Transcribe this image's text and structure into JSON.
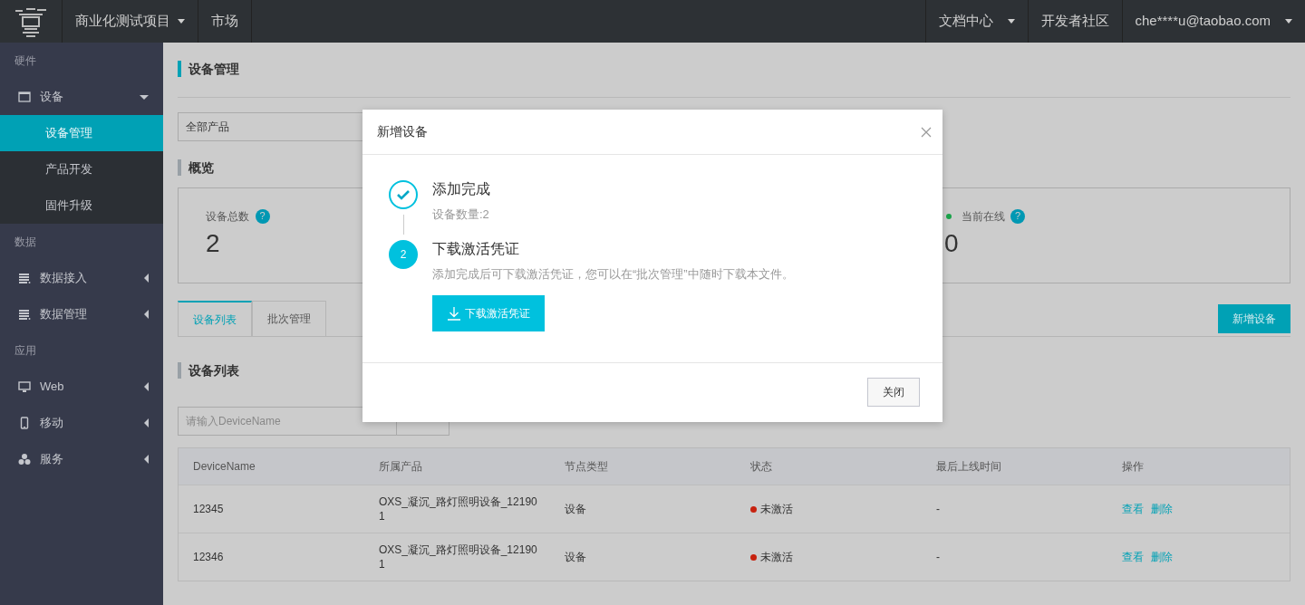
{
  "navbar": {
    "left_menus": [
      {
        "label": "商业化测试项目",
        "dropdown": true
      },
      {
        "label": "市场",
        "dropdown": false
      }
    ],
    "right_menus": [
      {
        "label": "文档中心",
        "dropdown": true
      },
      {
        "label": "开发者社区",
        "dropdown": false
      },
      {
        "label": "che****u@taobao.com",
        "dropdown": true
      }
    ]
  },
  "sidebar": {
    "sections": [
      {
        "heading": "硬件",
        "items": [
          {
            "label": "设备",
            "kind": "window",
            "expanded": true,
            "children": [
              {
                "label": "设备管理",
                "selected": true
              },
              {
                "label": "产品开发",
                "selected": false
              },
              {
                "label": "固件升级",
                "selected": false
              }
            ]
          }
        ]
      },
      {
        "heading": "数据",
        "items": [
          {
            "label": "数据接入",
            "kind": "list",
            "expanded": false
          },
          {
            "label": "数据管理",
            "kind": "list",
            "expanded": false
          }
        ]
      },
      {
        "heading": "应用",
        "items": [
          {
            "label": "Web",
            "kind": "monitor",
            "expanded": false
          },
          {
            "label": "移动",
            "kind": "phone",
            "expanded": false
          },
          {
            "label": "服务",
            "kind": "cluster",
            "expanded": false
          }
        ]
      }
    ]
  },
  "page_title": "设备管理",
  "product_select": {
    "value": "全部产品"
  },
  "overview": {
    "title": "概览",
    "stats": [
      {
        "label": "设备总数",
        "value": "2",
        "help": "?"
      },
      {
        "label": "当前在线",
        "value": "0",
        "help": "?",
        "color": "#1aa34a"
      }
    ]
  },
  "tabs": [
    {
      "label": "设备列表",
      "selected": true
    },
    {
      "label": "批次管理",
      "selected": false
    }
  ],
  "add_button": "新增设备",
  "list_title": "设备列表",
  "search": {
    "placeholder": "请输入DeviceName"
  },
  "table": {
    "columns": [
      "DeviceName",
      "所属产品",
      "节点类型",
      "状态",
      "最后上线时间",
      "操作"
    ],
    "rows": [
      {
        "cells": [
          "12345",
          "OXS_凝沉_路灯照明设备_121901",
          "设备",
          "未激活",
          "-"
        ],
        "color": "#c7220f",
        "actions": [
          "查看",
          "删除"
        ]
      },
      {
        "cells": [
          "12346",
          "OXS_凝沉_路灯照明设备_121901",
          "设备",
          "未激活",
          "-"
        ],
        "color": "#c7220f",
        "actions": [
          "查看",
          "删除"
        ]
      }
    ]
  },
  "modal": {
    "title": "新增设备",
    "steps": [
      {
        "kind": "done",
        "title": "添加完成",
        "description": "设备数量:2"
      },
      {
        "kind": "current",
        "marker": "2",
        "title": "下载激活凭证",
        "description": "添加完成后可下载激活凭证，您可以在“批次管理”中随时下载本文件。",
        "button": "下载激活凭证"
      }
    ],
    "close_button": "关闭"
  }
}
